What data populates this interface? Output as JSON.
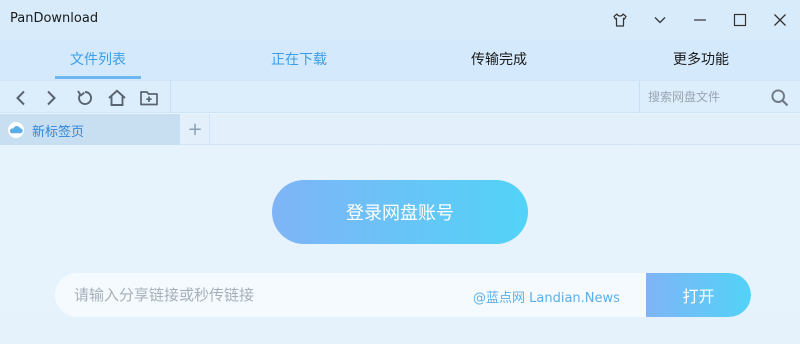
{
  "window": {
    "title": "PanDownload"
  },
  "tabs": [
    {
      "label": "文件列表",
      "active": true
    },
    {
      "label": "正在下载",
      "active": false
    },
    {
      "label": "传输完成",
      "active": false
    },
    {
      "label": "更多功能",
      "active": false
    }
  ],
  "toolbar": {
    "search_placeholder": "搜索网盘文件"
  },
  "page_tabs": {
    "current_label": "新标签页",
    "add_symbol": "+"
  },
  "main": {
    "login_label": "登录网盘账号",
    "share_placeholder": "请输入分享链接或秒传链接",
    "watermark": "@蓝点网 Landian.News",
    "open_label": "打开"
  },
  "colors": {
    "accent": "#3a9de8",
    "gradient_start": "#7fb4f7",
    "gradient_end": "#52d3f7"
  }
}
